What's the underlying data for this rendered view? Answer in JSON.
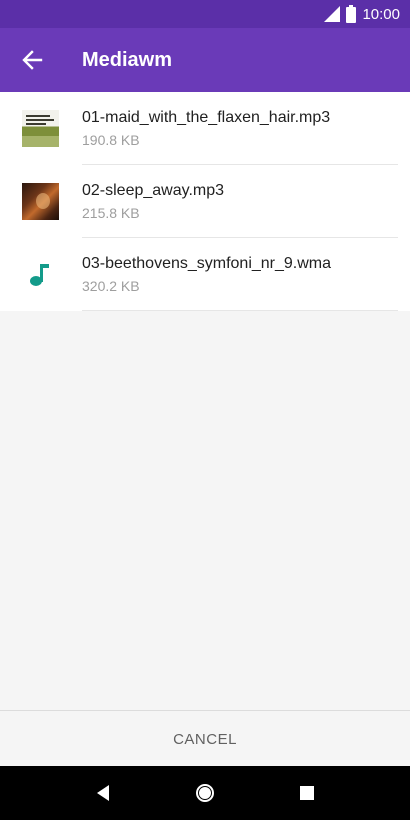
{
  "status_bar": {
    "time": "10:00",
    "signal_icon": "signal-icon",
    "battery_icon": "battery-icon"
  },
  "app_bar": {
    "title": "Mediawm",
    "back_icon": "arrow-back-icon",
    "color": "#6a3ab8"
  },
  "files": [
    {
      "name": "01-maid_with_the_flaxen_hair.mp3",
      "size": "190.8 KB",
      "icon": "album-art"
    },
    {
      "name": "02-sleep_away.mp3",
      "size": "215.8 KB",
      "icon": "album-art"
    },
    {
      "name": "03-beethovens_symfoni_nr_9.wma",
      "size": "320.2 KB",
      "icon": "music-note-icon"
    }
  ],
  "cancel_label": "CANCEL",
  "nav": {
    "back_icon": "nav-back-icon",
    "home_icon": "nav-home-icon",
    "recents_icon": "nav-recents-icon"
  },
  "colors": {
    "accent": "#6a3ab8",
    "note": "#139b8a"
  }
}
